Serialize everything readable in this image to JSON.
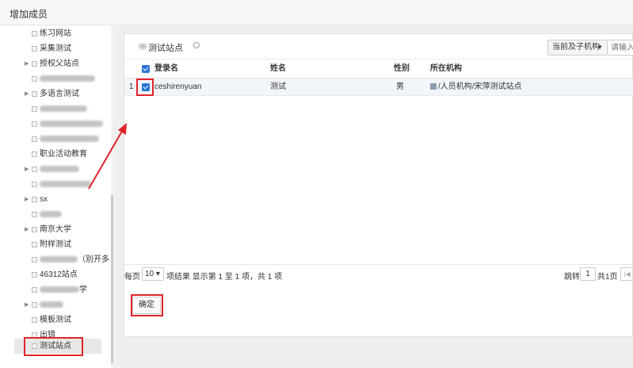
{
  "window": {
    "title": "增加成员"
  },
  "tree": {
    "items": [
      {
        "label": "练习网站",
        "has_arrow": false
      },
      {
        "label": "采集测试",
        "has_arrow": false
      },
      {
        "label": "授权父站点",
        "has_arrow": true
      },
      {
        "label": "",
        "has_arrow": false
      },
      {
        "label": "多语言测试",
        "has_arrow": true
      },
      {
        "label": "",
        "has_arrow": false
      },
      {
        "label": "",
        "has_arrow": false
      },
      {
        "label": "",
        "has_arrow": false
      },
      {
        "label": "职业活动教育",
        "has_arrow": false
      },
      {
        "label": "",
        "has_arrow": true
      },
      {
        "label": "",
        "has_arrow": false
      },
      {
        "label": "sx",
        "has_arrow": true
      },
      {
        "label": "",
        "has_arrow": false
      },
      {
        "label": "南京大学",
        "has_arrow": true
      },
      {
        "label": "附样测试",
        "has_arrow": false
      },
      {
        "label": "（别开多",
        "has_arrow": false
      },
      {
        "label": "46312站点",
        "has_arrow": false
      },
      {
        "label": "学",
        "has_arrow": false
      },
      {
        "label": "",
        "has_arrow": true
      },
      {
        "label": "模板测试",
        "has_arrow": false
      },
      {
        "label": "出错",
        "has_arrow": false
      },
      {
        "label": "测试站点",
        "has_arrow": false,
        "selected": true
      }
    ]
  },
  "panel": {
    "title": "测试站点",
    "scope_select": "当前及子机构",
    "search_placeholder": "请输入姓名",
    "columns": {
      "login": "登录名",
      "name": "姓名",
      "gender": "性别",
      "org": "所在机构"
    },
    "rows": [
      {
        "index": "1",
        "login": "ceshirenyuan",
        "name": "测试",
        "gender": "男",
        "org": "/人员机构/宋萍测试站点",
        "checked": true
      }
    ],
    "pager": {
      "prefix": "每页",
      "page_size": "10",
      "summary": "项结果 显示第 1 至 1 项，共 1 项",
      "jump_label": "跳转",
      "jump_value": "1",
      "total_pages": "共1页",
      "first_icon": "first-page-icon"
    },
    "confirm": "确定"
  },
  "colors": {
    "accent": "#2a74d4",
    "highlight": "#e0242c"
  }
}
